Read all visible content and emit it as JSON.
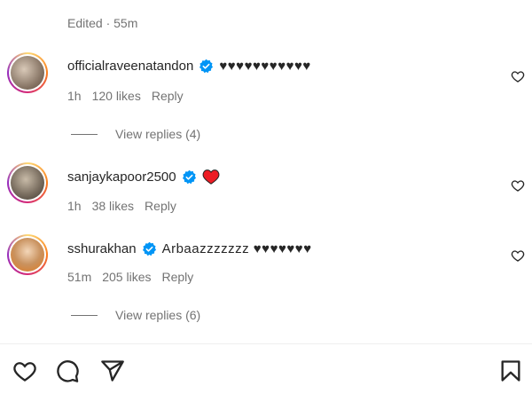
{
  "header": {
    "edited_text": "Edited · 55m"
  },
  "comments": [
    {
      "username": "officialraveenatandon",
      "text": "♥♥♥♥♥♥♥♥♥♥♥",
      "time": "1h",
      "likes": "120 likes",
      "reply_label": "Reply",
      "view_replies": "View replies (4)",
      "avatar_color": "#a89484"
    },
    {
      "username": "sanjaykapoor2500",
      "text": "",
      "emoji": "red-heart",
      "time": "1h",
      "likes": "38 likes",
      "reply_label": "Reply",
      "avatar_color": "#8c8172"
    },
    {
      "username": "sshurakhan",
      "text": "Arbaazzzzzzz ♥♥♥♥♥♥♥",
      "time": "51m",
      "likes": "205 likes",
      "reply_label": "Reply",
      "view_replies": "View replies (6)",
      "avatar_color": "#c9a27a"
    }
  ],
  "colors": {
    "verified": "#0095f6",
    "red_heart": "#ed1c24",
    "muted": "#737373"
  },
  "icons": {
    "verified": "verified-badge-icon",
    "comment_like": "heart-outline-icon",
    "action_like": "heart-outline-icon",
    "action_comment": "comment-bubble-icon",
    "action_share": "paper-plane-icon",
    "action_save": "bookmark-icon"
  }
}
